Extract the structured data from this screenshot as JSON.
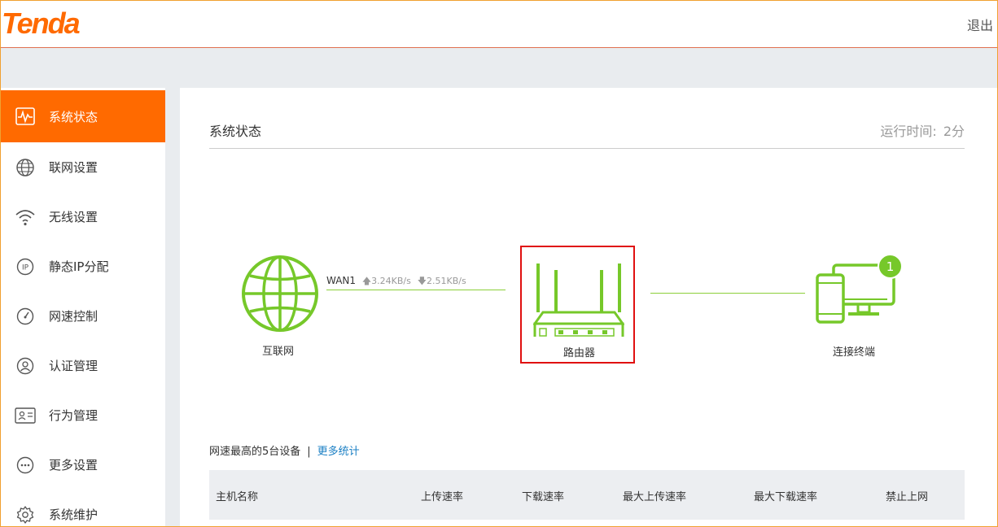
{
  "header": {
    "logo": "Tenda",
    "logout": "退出"
  },
  "sidebar": {
    "items": [
      {
        "label": "系统状态",
        "icon": "activity-icon",
        "active": true
      },
      {
        "label": "联网设置",
        "icon": "globe-icon"
      },
      {
        "label": "无线设置",
        "icon": "wifi-icon"
      },
      {
        "label": "静态IP分配",
        "icon": "ip-icon"
      },
      {
        "label": "网速控制",
        "icon": "speedometer-icon"
      },
      {
        "label": "认证管理",
        "icon": "user-circle-icon"
      },
      {
        "label": "行为管理",
        "icon": "id-card-icon"
      },
      {
        "label": "更多设置",
        "icon": "more-icon"
      },
      {
        "label": "系统维护",
        "icon": "gear-icon"
      }
    ]
  },
  "main": {
    "title": "系统状态",
    "uptime_label": "运行时间:",
    "uptime_value": "2分",
    "topology": {
      "internet_label": "互联网",
      "wan_name": "WAN1",
      "upload_rate": "3.24KB/s",
      "download_rate": "2.51KB/s",
      "router_label": "路由器",
      "clients_label": "连接终端",
      "clients_count": "1"
    },
    "stats": {
      "heading": "网速最高的5台设备",
      "separator": "|",
      "more_link": "更多统计",
      "columns": [
        "主机名称",
        "上传速率",
        "下载速率",
        "最大上传速率",
        "最大下载速率",
        "禁止上网"
      ]
    }
  },
  "colors": {
    "accent": "#ff6a00",
    "green": "#76c82a",
    "link": "#1a7fc4",
    "highlight": "#e01010"
  }
}
